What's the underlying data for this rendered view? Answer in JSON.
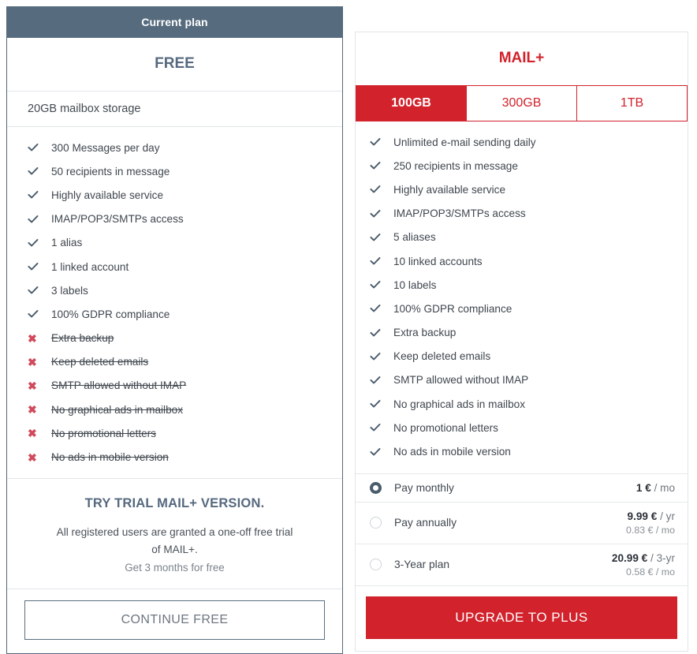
{
  "free_plan": {
    "badge": "Current plan",
    "title": "FREE",
    "storage": "20GB mailbox storage",
    "features": [
      {
        "label": "300 Messages per day",
        "included": true
      },
      {
        "label": "50 recipients in message",
        "included": true
      },
      {
        "label": "Highly available service",
        "included": true
      },
      {
        "label": "IMAP/POP3/SMTPs access",
        "included": true
      },
      {
        "label": "1 alias",
        "included": true
      },
      {
        "label": "1 linked account",
        "included": true
      },
      {
        "label": "3 labels",
        "included": true
      },
      {
        "label": "100% GDPR compliance",
        "included": true
      },
      {
        "label": "Extra backup",
        "included": false
      },
      {
        "label": "Keep deleted emails",
        "included": false
      },
      {
        "label": "SMTP allowed without IMAP",
        "included": false
      },
      {
        "label": "No graphical ads in mailbox",
        "included": false
      },
      {
        "label": "No promotional letters",
        "included": false
      },
      {
        "label": "No ads in mobile version",
        "included": false
      }
    ],
    "trial_heading": "TRY TRIAL MAIL+ VERSION.",
    "trial_text": "All registered users are granted a one-off free trial of MAIL+.",
    "trial_subtext": "Get 3 months for free",
    "cta": "CONTINUE FREE"
  },
  "plus_plan": {
    "title": "MAIL+",
    "storage_tabs": [
      {
        "label": "100GB",
        "selected": true
      },
      {
        "label": "300GB",
        "selected": false
      },
      {
        "label": "1TB",
        "selected": false
      }
    ],
    "features": [
      {
        "label": "Unlimited e-mail sending daily",
        "included": true
      },
      {
        "label": "250 recipients in message",
        "included": true
      },
      {
        "label": "Highly available service",
        "included": true
      },
      {
        "label": "IMAP/POP3/SMTPs access",
        "included": true
      },
      {
        "label": "5 aliases",
        "included": true
      },
      {
        "label": "10 linked accounts",
        "included": true
      },
      {
        "label": "10 labels",
        "included": true
      },
      {
        "label": "100% GDPR compliance",
        "included": true
      },
      {
        "label": "Extra backup",
        "included": true
      },
      {
        "label": "Keep deleted emails",
        "included": true
      },
      {
        "label": "SMTP allowed without IMAP",
        "included": true
      },
      {
        "label": "No graphical ads in mailbox",
        "included": true
      },
      {
        "label": "No promotional letters",
        "included": true
      },
      {
        "label": "No ads in mobile version",
        "included": true
      }
    ],
    "billing_options": [
      {
        "label": "Pay monthly",
        "amount": "1 €",
        "unit": "/ mo",
        "secondary": "",
        "selected": true
      },
      {
        "label": "Pay annually",
        "amount": "9.99 €",
        "unit": "/ yr",
        "secondary": "0.83 € / mo",
        "selected": false
      },
      {
        "label": "3-Year plan",
        "amount": "20.99 €",
        "unit": "/ 3-yr",
        "secondary": "0.58 € / mo",
        "selected": false
      }
    ],
    "cta": "UPGRADE TO PLUS"
  },
  "colors": {
    "slate": "#566b7e",
    "red": "#d2222c",
    "x_red": "#d1495b",
    "check": "#4a5b6b"
  }
}
